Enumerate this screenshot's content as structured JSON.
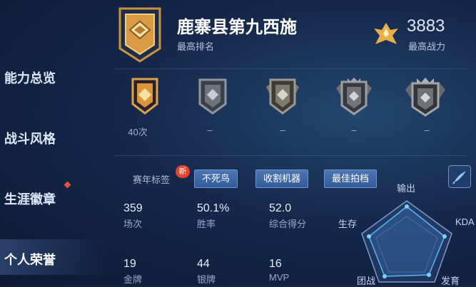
{
  "nav": {
    "items": [
      {
        "label": "能力总览"
      },
      {
        "label": "战斗风格"
      },
      {
        "label": "生涯徽章"
      },
      {
        "label": "个人荣誉"
      }
    ]
  },
  "header": {
    "title": "鹿寨县第九西施",
    "subtitle": "最高排名",
    "power_value": "3883",
    "power_label": "最高战力"
  },
  "ranks": [
    {
      "count": "40次",
      "tier": "gold"
    },
    {
      "count": "–",
      "tier": "silver"
    },
    {
      "count": "–",
      "tier": "silver"
    },
    {
      "count": "–",
      "tier": "silver"
    },
    {
      "count": "–",
      "tier": "silver"
    }
  ],
  "tags": {
    "label": "赛年标签",
    "new_badge": "新",
    "items": [
      "不死鸟",
      "收割机器",
      "最佳拍档"
    ]
  },
  "stats": [
    {
      "value": "359",
      "label": "场次"
    },
    {
      "value": "50.1%",
      "label": "胜率"
    },
    {
      "value": "52.0",
      "label": "综合得分"
    },
    {
      "value": "19",
      "label": "金牌"
    },
    {
      "value": "44",
      "label": "银牌"
    },
    {
      "value": "16",
      "label": "MVP"
    }
  ],
  "radar": {
    "labels": {
      "output": "输出",
      "survive": "生存",
      "kda": "KDA",
      "team": "团战",
      "develop": "发育"
    }
  },
  "colors": {
    "accent_gold": "#e8b04a",
    "tag_blue": "#3d68a8",
    "badge_red": "#e5432d"
  }
}
